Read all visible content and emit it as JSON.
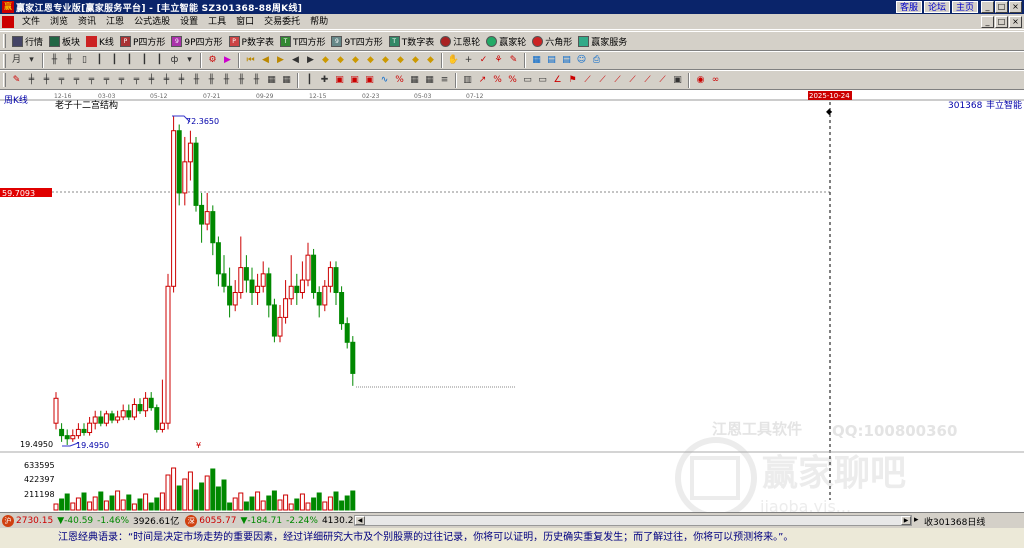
{
  "window": {
    "title": "赢家江恩专业版[赢家服务平台] - [丰立智能  SZ301368-88周K线]",
    "links": [
      "客服",
      "论坛",
      "主页"
    ]
  },
  "menu": [
    "文件",
    "浏览",
    "资讯",
    "江恩",
    "公式选股",
    "设置",
    "工具",
    "窗口",
    "交易委托",
    "帮助"
  ],
  "toolbar1": [
    {
      "label": "行情",
      "icon": "quote-grid-icon"
    },
    {
      "label": "板块",
      "icon": "sector-icon"
    },
    {
      "label": "K线",
      "icon": "kline-icon"
    },
    {
      "label": "P四方形",
      "icon": "p-square-icon"
    },
    {
      "label": "9P四方形",
      "icon": "9p-square-icon"
    },
    {
      "label": "P数字表",
      "icon": "p-table-icon"
    },
    {
      "label": "T四方形",
      "icon": "t-square-icon"
    },
    {
      "label": "9T四方形",
      "icon": "9t-square-icon"
    },
    {
      "label": "T数字表",
      "icon": "t-table-icon"
    },
    {
      "label": "江恩轮",
      "icon": "gann-wheel-icon"
    },
    {
      "label": "赢家轮",
      "icon": "winner-wheel-icon"
    },
    {
      "label": "六角形",
      "icon": "hexagon-icon"
    },
    {
      "label": "赢家服务",
      "icon": "service-icon"
    }
  ],
  "chart": {
    "period_label": "周K线",
    "indicator_title": "老子十二宫结构",
    "symbol": "301368",
    "name": "丰立智能",
    "cursor_date": "2025-10-24",
    "price_marker": "59.7093",
    "high_label": "72.3650",
    "low_label": "19.4950",
    "y_low_label": "19.4950",
    "date_ticks": [
      "12-16",
      "03-03",
      "05-12",
      "07-21",
      "09-29",
      "12-15",
      "02-23",
      "05-03",
      "07-12"
    ],
    "volume_ticks": [
      "633595",
      "422397",
      "211198"
    ],
    "watermark_line1": "江恩工具软件",
    "watermark_line2": "QQ:100800360",
    "watermark_logo": "赢家聊吧",
    "watermark_url": "jiaoba.yjs..."
  },
  "chart_data": {
    "type": "candlestick",
    "title": "老子十二宫结构",
    "x": [
      "12-16",
      "03-03",
      "05-12",
      "07-21",
      "09-29",
      "12-15",
      "02-23",
      "05-03",
      "07-12"
    ],
    "high": 72.365,
    "low": 19.495,
    "marker_price": 59.7093
  },
  "status": {
    "sh_index": "2730.15",
    "sh_change": "▼-40.59",
    "sh_pct": "-1.46%",
    "sh_amount": "3926.61亿",
    "sz_index": "6055.77",
    "sz_change": "▼-184.71",
    "sz_pct": "-2.24%",
    "sz_amount": "4130.2",
    "right_text": "收301368日线"
  },
  "quote": "江恩经典语录：“时间是决定市场走势的重要因素，经过详细研究大市及个别股票的过往记录，你将可以证明，历史确实重复发生；而了解过往，你将可以预测将来。”。"
}
